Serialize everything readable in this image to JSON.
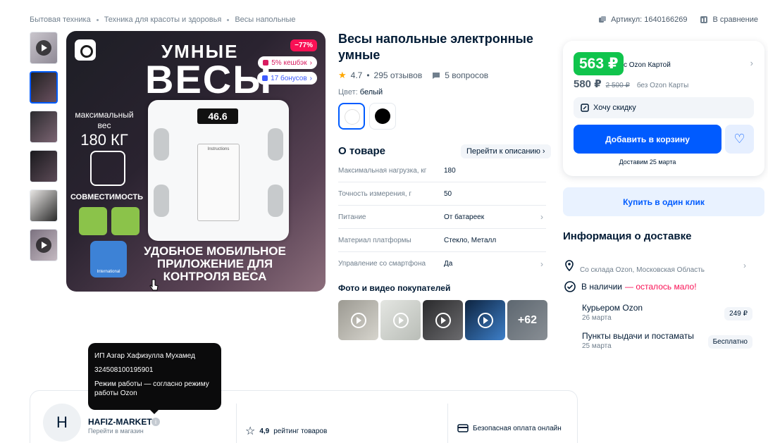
{
  "breadcrumb": [
    "Бытовая техника",
    "Техника для красоты и здоровья",
    "Весы напольные"
  ],
  "top_right": {
    "article": "Артикул: 1640166269",
    "compare": "В сравнение"
  },
  "image": {
    "headline_top": "УМНЫЕ",
    "headline_main": "ВЕСЫ",
    "discount": "−77%",
    "cashback": "5% кешбэк",
    "bonus": "17 бонусов",
    "max_weight_label": "максимальный вес",
    "max_weight_value": "180 КГ",
    "compatibility": "СОВМЕСТИМОСТЬ",
    "intl_label": "International",
    "scale_display": "46.6",
    "scale_sheet_title": "Instructions",
    "bottom_text": "УДОБНОЕ МОБИЛЬНОЕ ПРИЛОЖЕНИЕ ДЛЯ КОНТРОЛЯ ВЕСА"
  },
  "product": {
    "title": "Весы напольные электронные умные",
    "rating": "4.7",
    "reviews": "295 отзывов",
    "questions": "5 вопросов",
    "color_label": "Цвет:",
    "color_value": "белый",
    "about_heading": "О товаре",
    "about_link": "Перейти к описанию",
    "specs": [
      {
        "k": "Максимальная нагрузка, кг",
        "v": "180",
        "arrow": false
      },
      {
        "k": "Точность измерения, г",
        "v": "50",
        "arrow": false
      },
      {
        "k": "Питание",
        "v": "От батареек",
        "arrow": true
      },
      {
        "k": "Материал платформы",
        "v": "Стекло, Металл",
        "arrow": false
      },
      {
        "k": "Управление со смартфона",
        "v": "Да",
        "arrow": true
      }
    ],
    "photos_heading": "Фото и видео покупателей",
    "photos_more": "+62"
  },
  "price": {
    "card_price": "563 ₽",
    "card_label": "с Ozon Картой",
    "regular_price": "580 ₽",
    "old_price": "2 500 ₽",
    "no_card_label": "без Ozon Карты",
    "want_discount": "Хочу скидку",
    "add_to_cart": "Добавить в корзину",
    "delivery_date": "Доставим 25 марта",
    "buy_one_click": "Купить в один клик"
  },
  "delivery": {
    "heading": "Информация о доставке",
    "warehouse": "Со склада Ozon, Московская Область",
    "stock": "В наличии",
    "stock_note": "— осталось мало!",
    "courier": "Курьером Ozon",
    "courier_date": "26 марта",
    "courier_price": "249 ₽",
    "pickup": "Пункты выдачи и постаматы",
    "pickup_date": "25 марта",
    "pickup_price": "Бесплатно"
  },
  "tooltip": {
    "line1": "ИП Азгар Хафизулла Мухамед",
    "line2": "324508100195901",
    "line3": "Режим работы — согласно режиму работы Ozon"
  },
  "seller": {
    "avatar_letter": "H",
    "name": "HAFIZ-MARKET",
    "go_to_shop": "Перейти в магазин",
    "rating_value": "4,9",
    "rating_label": "рейтинг товаров",
    "safe_payment": "Безопасная оплата онлайн"
  },
  "colors": {
    "accent": "#005bff",
    "green": "#10c44c",
    "discount": "#f91155",
    "warning": "#f91155"
  }
}
